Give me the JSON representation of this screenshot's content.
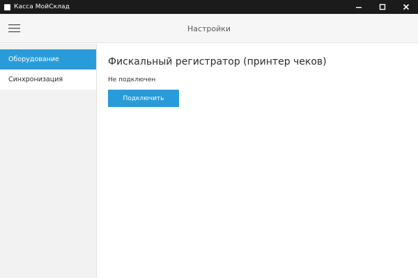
{
  "window": {
    "title": "Касса МойСклад",
    "controls": [
      "minimize-icon",
      "maximize-icon",
      "close-icon"
    ]
  },
  "header": {
    "menu_icon": "hamburger-menu-icon",
    "title": "Настройки"
  },
  "sidebar": {
    "items": [
      {
        "label": "Оборудование",
        "active": true
      },
      {
        "label": "Синхронизация",
        "active": false
      }
    ]
  },
  "main": {
    "section_title": "Фискальный регистратор (принтер чеков)",
    "status": "Не подключен",
    "connect_label": "Подключить"
  },
  "colors": {
    "accent": "#2a9bd9",
    "titlebar": "#1b1b1b",
    "header_bg": "#f6f6f6",
    "sidebar_bg": "#f2f2f2"
  }
}
